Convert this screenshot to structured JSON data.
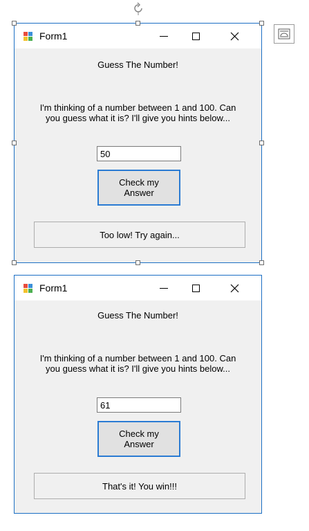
{
  "form1": {
    "title": "Form1",
    "heading": "Guess The Number!",
    "description": "I'm thinking of a number between 1 and 100. Can you guess what it is? I'll give you hints below...",
    "input_value": "50",
    "button_label": "Check my Answer",
    "result": "Too low! Try again..."
  },
  "form2": {
    "title": "Form1",
    "heading": "Guess The Number!",
    "description": "I'm thinking of a number between 1 and 100. Can you guess what it is? I'll give you hints below...",
    "input_value": "61",
    "button_label": "Check my Answer",
    "result": "That's it! You win!!!"
  },
  "icons": {
    "app": "form-app-icon",
    "minimize": "minimize-icon",
    "maximize": "maximize-icon",
    "close": "close-icon",
    "rotate": "rotate-handle-icon",
    "smart_tag": "smart-tag-icon"
  },
  "colors": {
    "window_border": "#1c6fc4",
    "button_focus_border": "#2a7bd3",
    "form_background": "#f0f0f0"
  }
}
